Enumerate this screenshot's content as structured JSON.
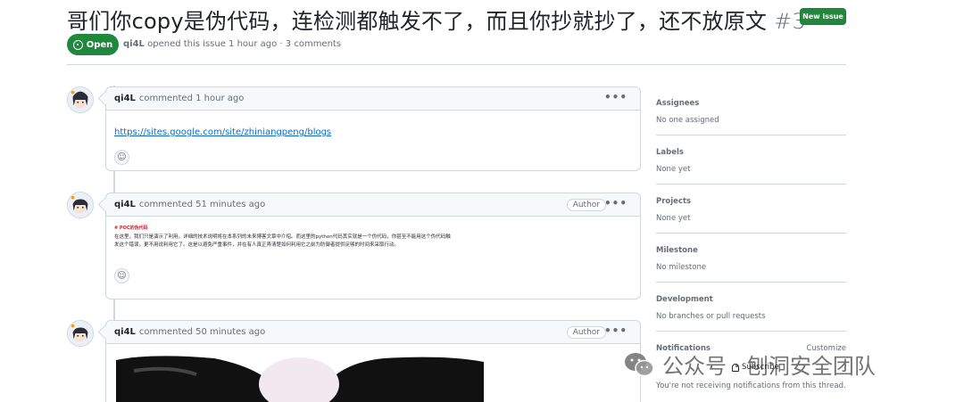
{
  "issue": {
    "title": "哥们你copy是伪代码，连检测都触发不了，而且你抄就抄了，还不放原文",
    "number": "#3",
    "state": "Open",
    "author": "qi4L",
    "meta_rest": "opened this issue 1 hour ago · 3 comments"
  },
  "header": {
    "new_issue_label": "New issue"
  },
  "comments": [
    {
      "author": "qi4L",
      "time": "commented 1 hour ago",
      "link": "https://sites.google.com/site/zhiniangpeng/blogs"
    },
    {
      "author": "qi4L",
      "time": "commented 51 minutes ago",
      "badge": "Author",
      "poc_title": "# POC的伪代码",
      "poc_text": "在这里，我们只是演示了利用。详细的技术说明将在本系列的未来博客文章中介绍。而这里的python代码其实就是一个伪代码，你甚至不能用这个伪代码触发这个错误，更不用说利用它了。这是以避免严重事件，并在有人真正弄清楚如何利用它之前为防御者提供足够的时间来采取行动。"
    },
    {
      "author": "qi4L",
      "time": "commented 50 minutes ago",
      "badge": "Author"
    }
  ],
  "sidebar": {
    "assignees_h": "Assignees",
    "assignees_v": "No one assigned",
    "labels_h": "Labels",
    "labels_v": "None yet",
    "projects_h": "Projects",
    "projects_v": "None yet",
    "milestone_h": "Milestone",
    "milestone_v": "No milestone",
    "development_h": "Development",
    "development_v": "No branches or pull requests",
    "notifications_h": "Notifications",
    "customize": "Customize",
    "subscribe": "Subscribe",
    "not_receiving": "You're not receiving notifications from this thread."
  },
  "watermark": {
    "text": "公众号 · 刨洞安全团队"
  },
  "dots": "•••",
  "emoji_glyph": "☺"
}
